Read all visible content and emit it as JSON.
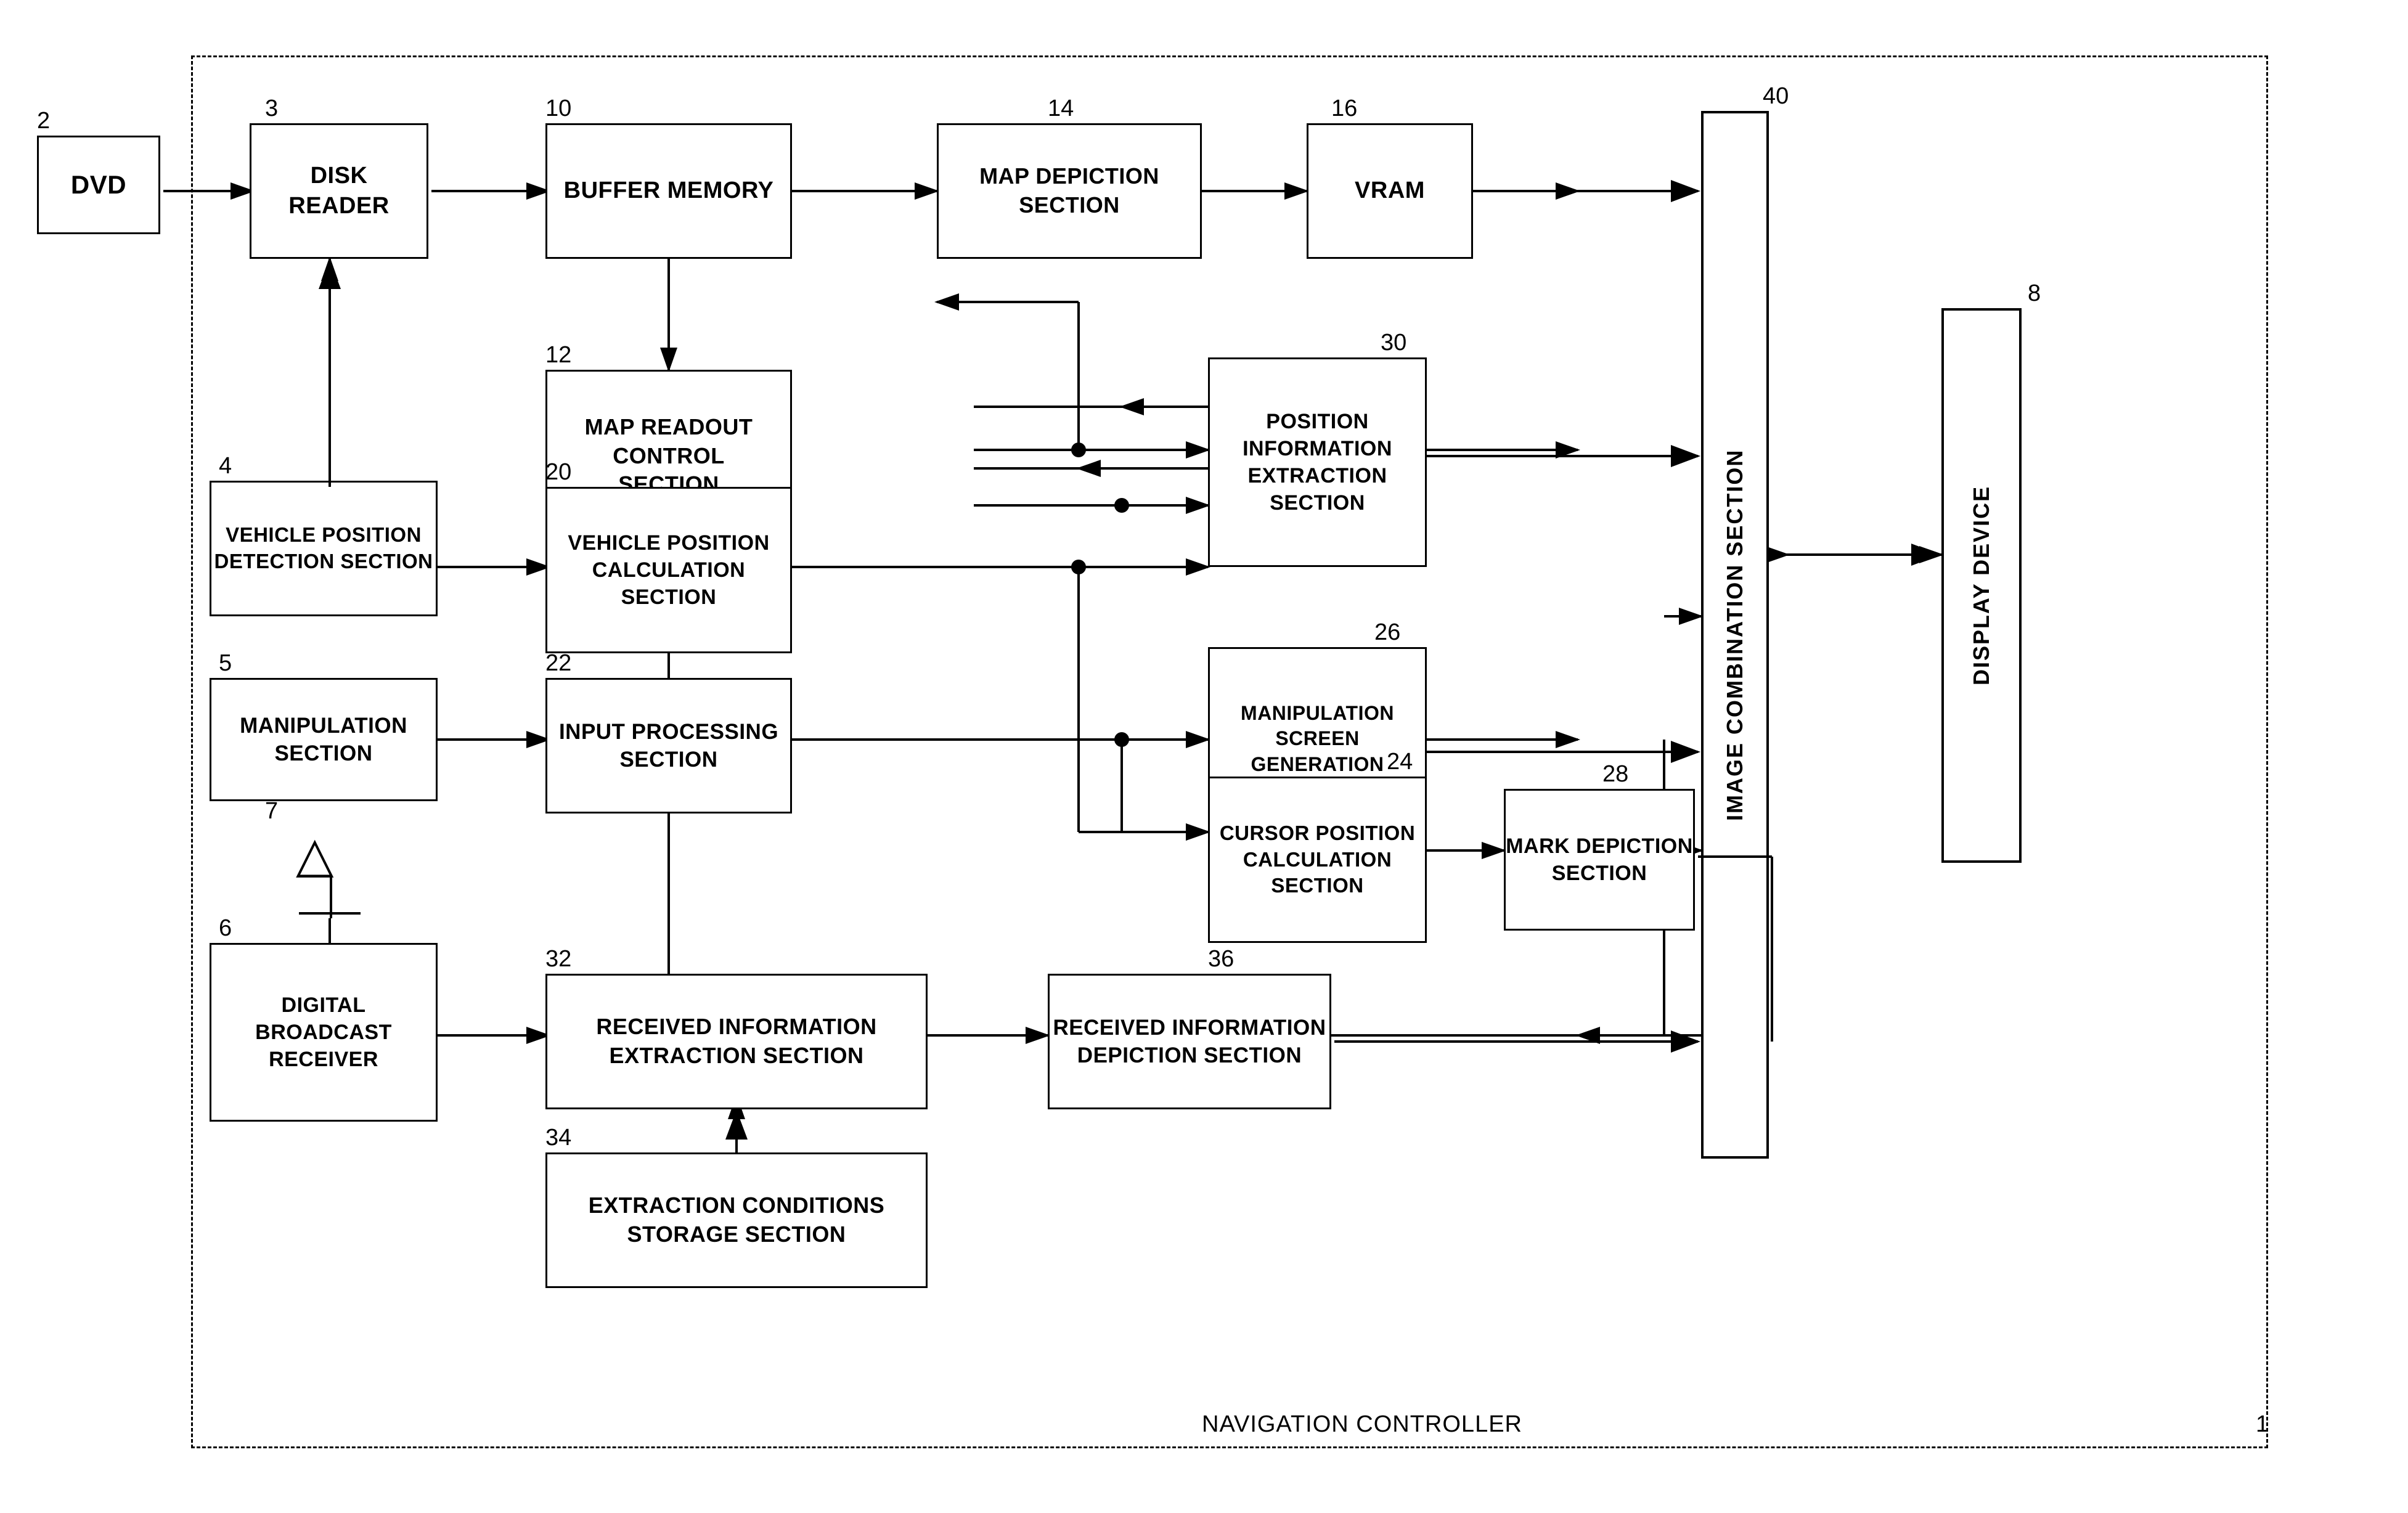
{
  "diagram": {
    "title": "NAVIGATION CONTROLLER",
    "blocks": {
      "dvd": {
        "label": "DVD",
        "num": "2"
      },
      "disk_reader": {
        "label": "DISK\nREADER",
        "num": "3"
      },
      "buffer_memory": {
        "label": "BUFFER MEMORY",
        "num": "10"
      },
      "map_depiction": {
        "label": "MAP DEPICTION\nSECTION",
        "num": "14"
      },
      "vram": {
        "label": "VRAM",
        "num": "16"
      },
      "map_readout": {
        "label": "MAP READOUT\nCONTROL\nSECTION",
        "num": "12"
      },
      "position_info": {
        "label": "POSITION\nINFORMATION\nEXTRACTION\nSECTION",
        "num": "30"
      },
      "vehicle_pos_detect": {
        "label": "VEHICLE POSITION\nDETECTION SECTION",
        "num": "4"
      },
      "vehicle_pos_calc": {
        "label": "VEHICLE POSITION\nCALCULATION\nSECTION",
        "num": "20"
      },
      "manipulation_section": {
        "label": "MANIPULATION\nSECTION",
        "num": "5"
      },
      "input_processing": {
        "label": "INPUT PROCESSING\nSECTION",
        "num": "22"
      },
      "manipulation_screen": {
        "label": "MANIPULATION\nSCREEN\nGENERATION\nSECTION",
        "num": "26"
      },
      "cursor_pos": {
        "label": "CURSOR POSITION\nCALCULATION\nSECTION",
        "num": "24"
      },
      "mark_depiction": {
        "label": "MARK DEPICTION\nSECTION",
        "num": "28"
      },
      "digital_broadcast": {
        "label": "DIGITAL\nBROADCAST\nRECEIVER",
        "num": "6"
      },
      "antenna": {
        "num": "7"
      },
      "received_info_extract": {
        "label": "RECEIVED INFORMATION\nEXTRACTION SECTION",
        "num": "32"
      },
      "received_info_depict": {
        "label": "RECEIVED INFORMATION\nDEPICTION SECTION",
        "num": "36"
      },
      "extraction_cond": {
        "label": "EXTRACTION CONDITIONS\nSTORAGE SECTION",
        "num": "34"
      },
      "image_combination": {
        "label": "IMAGE COMBINATION SECTION",
        "num": "40"
      },
      "display_device": {
        "label": "DISPLAY DEVICE",
        "num": "8"
      }
    },
    "nav_controller_label": "NAVIGATION CONTROLLER",
    "nav_controller_num": "1"
  }
}
